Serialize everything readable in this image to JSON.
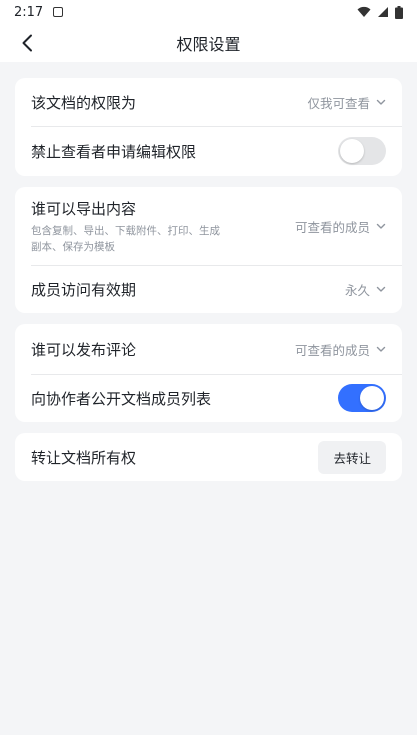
{
  "status_bar": {
    "time": "2:17"
  },
  "nav": {
    "title": "权限设置"
  },
  "cards": [
    {
      "rows": [
        {
          "label": "该文档的权限为",
          "value": "仅我可查看"
        },
        {
          "label": "禁止查看者申请编辑权限",
          "toggle": "off"
        }
      ]
    },
    {
      "rows": [
        {
          "label": "谁可以导出内容",
          "sub": "包含复制、导出、下载附件、打印、生成副本、保存为模板",
          "value": "可查看的成员"
        },
        {
          "label": "成员访问有效期",
          "value": "永久"
        }
      ]
    },
    {
      "rows": [
        {
          "label": "谁可以发布评论",
          "value": "可查看的成员"
        },
        {
          "label": "向协作者公开文档成员列表",
          "toggle": "on"
        }
      ]
    },
    {
      "rows": [
        {
          "label": "转让文档所有权",
          "button": "去转让"
        }
      ]
    }
  ],
  "colors": {
    "accent": "#3370ff",
    "background": "#f4f5f7"
  }
}
